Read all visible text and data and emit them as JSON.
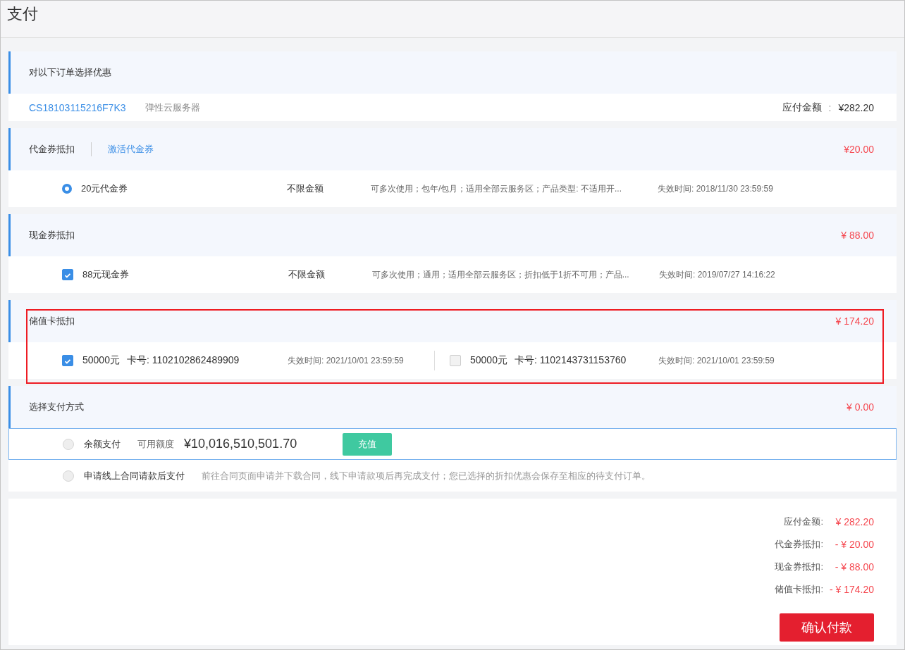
{
  "title": "支付",
  "order_section": {
    "heading": "对以下订单选择优惠",
    "order_id": "CS18103115216F7K3",
    "product": "弹性云服务器",
    "amount_label": "应付金额",
    "colon": ":",
    "amount": "¥282.20"
  },
  "discount_sections": [
    {
      "kind": "coupon",
      "heading": "代金券抵扣",
      "link": "激活代金券",
      "total": "¥20.00",
      "items": [
        {
          "kind": "radio",
          "checked": true,
          "name": "20元代金券",
          "limit": "不限金额",
          "description": "可多次使用；包年/包月；适用全部云服务区；产品类型: 不适用开...",
          "expiry": "失效时间: 2018/11/30 23:59:59"
        }
      ]
    },
    {
      "kind": "coupon",
      "heading": "现金券抵扣",
      "total": "¥ 88.00",
      "items": [
        {
          "kind": "checkbox",
          "checked": true,
          "name": "88元现金券",
          "limit": "不限金额",
          "description": "可多次使用；通用；适用全部云服务区；折扣低于1折不可用；产品...",
          "expiry": "失效时间: 2019/07/27 14:16:22"
        }
      ]
    },
    {
      "kind": "card",
      "heading": "储值卡抵扣",
      "total": "¥ 174.20",
      "highlighted": true,
      "items": [
        {
          "checked": true,
          "amount": "50000元",
          "card_no": "卡号: 1102102862489909",
          "expiry": "失效时间: 2021/10/01 23:59:59"
        },
        {
          "checked": false,
          "amount": "50000元",
          "card_no": "卡号: 1102143731153760",
          "expiry": "失效时间: 2021/10/01 23:59:59"
        }
      ]
    }
  ],
  "payment_section": {
    "heading": "选择支付方式",
    "total": "¥ 0.00",
    "methods": [
      {
        "kind": "balance",
        "selected": false,
        "focused": true,
        "name": "余额支付",
        "balance_label": "可用额度",
        "balance": "¥10,016,510,501.70",
        "button": "充值"
      },
      {
        "kind": "contract",
        "selected": false,
        "focused": false,
        "name": "申请线上合同请款后支付",
        "note": "前往合同页面申请并下载合同，线下申请款项后再完成支付；您已选择的折扣优惠会保存至相应的待支付订单。"
      }
    ]
  },
  "summary": {
    "lines": [
      {
        "label": "应付金额:",
        "value": "¥ 282.20"
      },
      {
        "label": "代金券抵扣:",
        "value": "- ¥ 20.00"
      },
      {
        "label": "现金券抵扣:",
        "value": "- ¥ 88.00"
      },
      {
        "label": "储值卡抵扣:",
        "value": "- ¥ 174.20"
      }
    ],
    "button": "确认付款"
  }
}
